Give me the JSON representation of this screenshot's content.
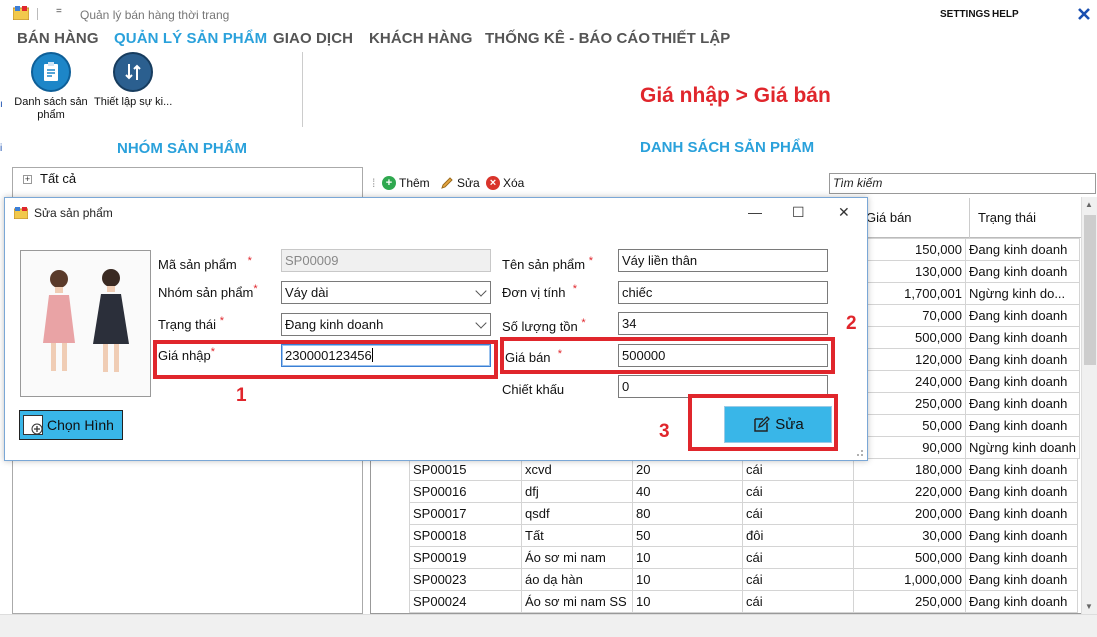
{
  "window": {
    "title": "Quản lý bán hàng thời trang",
    "settings_label": "SETTINGS",
    "help_label": "HELP",
    "menu_glyph": "="
  },
  "ribbon": {
    "tabs": [
      {
        "label": "BÁN HÀNG",
        "active": false
      },
      {
        "label": "QUẢN LÝ SẢN PHẨM",
        "active": true
      },
      {
        "label": "GIAO DỊCH",
        "active": false
      },
      {
        "label": "KHÁCH HÀNG",
        "active": false
      },
      {
        "label": "THỐNG KÊ - BÁO CÁO",
        "active": false
      },
      {
        "label": "THIẾT LẬP",
        "active": false
      }
    ],
    "buttons": [
      {
        "label": "Danh sách sản phẩm",
        "icon": "clipboard-icon"
      },
      {
        "label": "Thiết lập sự ki...",
        "icon": "exchange-icon"
      }
    ]
  },
  "annotation_note": "Giá nhập > Giá bán",
  "left_panel": {
    "title": "NHÓM SẢN PHẨM",
    "tree": [
      {
        "label": "Tất cả",
        "expander": "+"
      }
    ]
  },
  "right_panel": {
    "title": "DANH SÁCH SẢN PHẨM",
    "toolbar": {
      "add": "Thêm",
      "edit": "Sửa",
      "delete": "Xóa"
    },
    "search_value": "Tìm kiếm",
    "visible_headers": [
      "Giá bán",
      "Trạng thái"
    ],
    "rows_top": [
      [
        "150,000",
        "Đang kinh doanh"
      ],
      [
        "130,000",
        "Đang kinh doanh"
      ],
      [
        "1,700,001",
        "Ngừng kinh do..."
      ],
      [
        "70,000",
        "Đang kinh doanh"
      ],
      [
        "500,000",
        "Đang kinh doanh"
      ],
      [
        "120,000",
        "Đang kinh doanh"
      ],
      [
        "240,000",
        "Đang kinh doanh"
      ],
      [
        "250,000",
        "Đang kinh doanh"
      ],
      [
        "50,000",
        "Đang kinh doanh"
      ],
      [
        "90,000",
        "Ngừng kinh doanh"
      ]
    ],
    "rows": [
      [
        "SP00015",
        "xcvd",
        "20",
        "cái",
        "180,000",
        "Đang kinh doanh"
      ],
      [
        "SP00016",
        "dfj",
        "40",
        "cái",
        "220,000",
        "Đang kinh doanh"
      ],
      [
        "SP00017",
        "qsdf",
        "80",
        "cái",
        "200,000",
        "Đang kinh doanh"
      ],
      [
        "SP00018",
        "Tất",
        "50",
        "đôi",
        "30,000",
        "Đang kinh doanh"
      ],
      [
        "SP00019",
        "Áo sơ mi nam",
        "10",
        "cái",
        "500,000",
        "Đang kinh doanh"
      ],
      [
        "SP00023",
        "áo dạ hàn",
        "10",
        "cái",
        "1,000,000",
        "Đang kinh doanh"
      ],
      [
        "SP00024",
        "Áo sơ mi nam SS",
        "10",
        "cái",
        "250,000",
        "Đang kinh doanh"
      ]
    ]
  },
  "dialog": {
    "title": "Sửa sản phẩm",
    "minimize": "—",
    "maximize": "☐",
    "close": "✕",
    "pick_image_label": "Chọn Hình",
    "edit_button_label": "Sửa",
    "required_mark": "*",
    "fields": {
      "ma_sp_label": "Mã sản phẩm",
      "ma_sp_value": "SP00009",
      "nhom_label": "Nhóm sản phẩm",
      "nhom_value": "Váy dài",
      "trang_thai_label": "Trạng thái",
      "trang_thai_value": "Đang kinh doanh",
      "gia_nhap_label": "Giá nhập",
      "gia_nhap_value": "230000123456",
      "ten_label": "Tên sản phẩm",
      "ten_value": "Váy liền thân",
      "don_vi_label": "Đơn vị tính",
      "don_vi_value": "chiếc",
      "so_luong_label": "Số lượng tồn",
      "so_luong_value": "34",
      "gia_ban_label": "Giá bán",
      "gia_ban_value": "500000",
      "chiet_khau_label": "Chiết khấu",
      "chiet_khau_value": "0"
    }
  },
  "annotations": {
    "n1": "1",
    "n2": "2",
    "n3": "3",
    "color": "#e0262c"
  },
  "colors": {
    "accent": "#2aa1db",
    "button": "#39b6e8",
    "note": "#e0262c"
  }
}
